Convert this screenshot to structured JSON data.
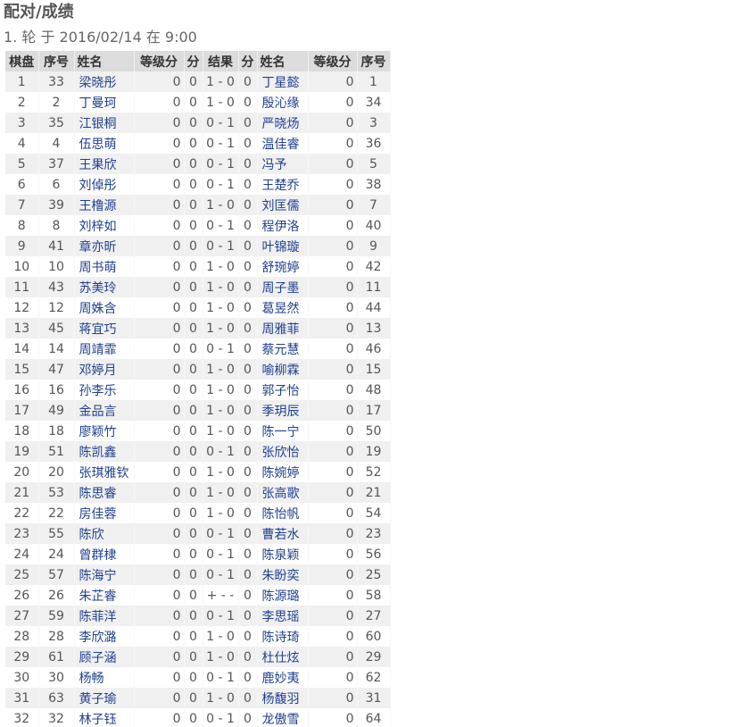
{
  "page": {
    "title": "配对/成绩",
    "round_info": "1. 轮 于 2016/02/14 在 9:00"
  },
  "table": {
    "headers": [
      "棋盘",
      "序号",
      "姓名",
      "等级分",
      "分",
      "结果",
      "分",
      "姓名",
      "等级分",
      "序号"
    ],
    "rows": [
      {
        "board": "1",
        "no1": "33",
        "name1": "梁晓彤",
        "rating1": "0",
        "pts1": "0",
        "result": "1 - 0",
        "pts2": "0",
        "name2": "丁星懿",
        "rating2": "0",
        "no2": "1"
      },
      {
        "board": "2",
        "no1": "2",
        "name1": "丁曼珂",
        "rating1": "0",
        "pts1": "0",
        "result": "1 - 0",
        "pts2": "0",
        "name2": "殷沁缘",
        "rating2": "0",
        "no2": "34"
      },
      {
        "board": "3",
        "no1": "35",
        "name1": "江银桐",
        "rating1": "0",
        "pts1": "0",
        "result": "0 - 1",
        "pts2": "0",
        "name2": "严晓炀",
        "rating2": "0",
        "no2": "3"
      },
      {
        "board": "4",
        "no1": "4",
        "name1": "伍思萌",
        "rating1": "0",
        "pts1": "0",
        "result": "0 - 1",
        "pts2": "0",
        "name2": "温佳睿",
        "rating2": "0",
        "no2": "36"
      },
      {
        "board": "5",
        "no1": "37",
        "name1": "王果欣",
        "rating1": "0",
        "pts1": "0",
        "result": "0 - 1",
        "pts2": "0",
        "name2": "冯予",
        "rating2": "0",
        "no2": "5"
      },
      {
        "board": "6",
        "no1": "6",
        "name1": "刘倬彤",
        "rating1": "0",
        "pts1": "0",
        "result": "0 - 1",
        "pts2": "0",
        "name2": "王楚乔",
        "rating2": "0",
        "no2": "38"
      },
      {
        "board": "7",
        "no1": "39",
        "name1": "王橹源",
        "rating1": "0",
        "pts1": "0",
        "result": "1 - 0",
        "pts2": "0",
        "name2": "刘匡儒",
        "rating2": "0",
        "no2": "7"
      },
      {
        "board": "8",
        "no1": "8",
        "name1": "刘梓如",
        "rating1": "0",
        "pts1": "0",
        "result": "0 - 1",
        "pts2": "0",
        "name2": "程伊洛",
        "rating2": "0",
        "no2": "40"
      },
      {
        "board": "9",
        "no1": "41",
        "name1": "章亦昕",
        "rating1": "0",
        "pts1": "0",
        "result": "0 - 1",
        "pts2": "0",
        "name2": "叶锦璇",
        "rating2": "0",
        "no2": "9"
      },
      {
        "board": "10",
        "no1": "10",
        "name1": "周书萌",
        "rating1": "0",
        "pts1": "0",
        "result": "1 - 0",
        "pts2": "0",
        "name2": "舒琬婷",
        "rating2": "0",
        "no2": "42"
      },
      {
        "board": "11",
        "no1": "43",
        "name1": "苏美玲",
        "rating1": "0",
        "pts1": "0",
        "result": "1 - 0",
        "pts2": "0",
        "name2": "周子墨",
        "rating2": "0",
        "no2": "11"
      },
      {
        "board": "12",
        "no1": "12",
        "name1": "周姝含",
        "rating1": "0",
        "pts1": "0",
        "result": "1 - 0",
        "pts2": "0",
        "name2": "葛昱然",
        "rating2": "0",
        "no2": "44"
      },
      {
        "board": "13",
        "no1": "45",
        "name1": "蒋宜巧",
        "rating1": "0",
        "pts1": "0",
        "result": "1 - 0",
        "pts2": "0",
        "name2": "周雅菲",
        "rating2": "0",
        "no2": "13"
      },
      {
        "board": "14",
        "no1": "14",
        "name1": "周靖霏",
        "rating1": "0",
        "pts1": "0",
        "result": "0 - 1",
        "pts2": "0",
        "name2": "蔡元慧",
        "rating2": "0",
        "no2": "46"
      },
      {
        "board": "15",
        "no1": "47",
        "name1": "邓婷月",
        "rating1": "0",
        "pts1": "0",
        "result": "1 - 0",
        "pts2": "0",
        "name2": "喻柳霖",
        "rating2": "0",
        "no2": "15"
      },
      {
        "board": "16",
        "no1": "16",
        "name1": "孙李乐",
        "rating1": "0",
        "pts1": "0",
        "result": "1 - 0",
        "pts2": "0",
        "name2": "郭子怡",
        "rating2": "0",
        "no2": "48"
      },
      {
        "board": "17",
        "no1": "49",
        "name1": "金品言",
        "rating1": "0",
        "pts1": "0",
        "result": "1 - 0",
        "pts2": "0",
        "name2": "季玥辰",
        "rating2": "0",
        "no2": "17"
      },
      {
        "board": "18",
        "no1": "18",
        "name1": "廖颖竹",
        "rating1": "0",
        "pts1": "0",
        "result": "1 - 0",
        "pts2": "0",
        "name2": "陈一宁",
        "rating2": "0",
        "no2": "50"
      },
      {
        "board": "19",
        "no1": "51",
        "name1": "陈凯鑫",
        "rating1": "0",
        "pts1": "0",
        "result": "0 - 1",
        "pts2": "0",
        "name2": "张欣怡",
        "rating2": "0",
        "no2": "19"
      },
      {
        "board": "20",
        "no1": "20",
        "name1": "张琪雅钦",
        "rating1": "0",
        "pts1": "0",
        "result": "1 - 0",
        "pts2": "0",
        "name2": "陈婉婷",
        "rating2": "0",
        "no2": "52"
      },
      {
        "board": "21",
        "no1": "53",
        "name1": "陈思睿",
        "rating1": "0",
        "pts1": "0",
        "result": "1 - 0",
        "pts2": "0",
        "name2": "张高歌",
        "rating2": "0",
        "no2": "21"
      },
      {
        "board": "22",
        "no1": "22",
        "name1": "房佳蓉",
        "rating1": "0",
        "pts1": "0",
        "result": "1 - 0",
        "pts2": "0",
        "name2": "陈怡帆",
        "rating2": "0",
        "no2": "54"
      },
      {
        "board": "23",
        "no1": "55",
        "name1": "陈欣",
        "rating1": "0",
        "pts1": "0",
        "result": "0 - 1",
        "pts2": "0",
        "name2": "曹若水",
        "rating2": "0",
        "no2": "23"
      },
      {
        "board": "24",
        "no1": "24",
        "name1": "曾群棣",
        "rating1": "0",
        "pts1": "0",
        "result": "0 - 1",
        "pts2": "0",
        "name2": "陈泉颖",
        "rating2": "0",
        "no2": "56"
      },
      {
        "board": "25",
        "no1": "57",
        "name1": "陈海宁",
        "rating1": "0",
        "pts1": "0",
        "result": "0 - 1",
        "pts2": "0",
        "name2": "朱盼奕",
        "rating2": "0",
        "no2": "25"
      },
      {
        "board": "26",
        "no1": "26",
        "name1": "朱芷睿",
        "rating1": "0",
        "pts1": "0",
        "result": "+ - -",
        "pts2": "0",
        "name2": "陈源璐",
        "rating2": "0",
        "no2": "58"
      },
      {
        "board": "27",
        "no1": "59",
        "name1": "陈菲洋",
        "rating1": "0",
        "pts1": "0",
        "result": "0 - 1",
        "pts2": "0",
        "name2": "李思瑶",
        "rating2": "0",
        "no2": "27"
      },
      {
        "board": "28",
        "no1": "28",
        "name1": "李欣潞",
        "rating1": "0",
        "pts1": "0",
        "result": "1 - 0",
        "pts2": "0",
        "name2": "陈诗琦",
        "rating2": "0",
        "no2": "60"
      },
      {
        "board": "29",
        "no1": "61",
        "name1": "顾子涵",
        "rating1": "0",
        "pts1": "0",
        "result": "1 - 0",
        "pts2": "0",
        "name2": "杜仕炫",
        "rating2": "0",
        "no2": "29"
      },
      {
        "board": "30",
        "no1": "30",
        "name1": "杨畅",
        "rating1": "0",
        "pts1": "0",
        "result": "0 - 1",
        "pts2": "0",
        "name2": "鹿妙夷",
        "rating2": "0",
        "no2": "62"
      },
      {
        "board": "31",
        "no1": "63",
        "name1": "黄子瑜",
        "rating1": "0",
        "pts1": "0",
        "result": "1 - 0",
        "pts2": "0",
        "name2": "杨馥羽",
        "rating2": "0",
        "no2": "31"
      },
      {
        "board": "32",
        "no1": "32",
        "name1": "林子钰",
        "rating1": "0",
        "pts1": "0",
        "result": "0 - 1",
        "pts2": "0",
        "name2": "龙傲雪",
        "rating2": "0",
        "no2": "64"
      }
    ]
  }
}
